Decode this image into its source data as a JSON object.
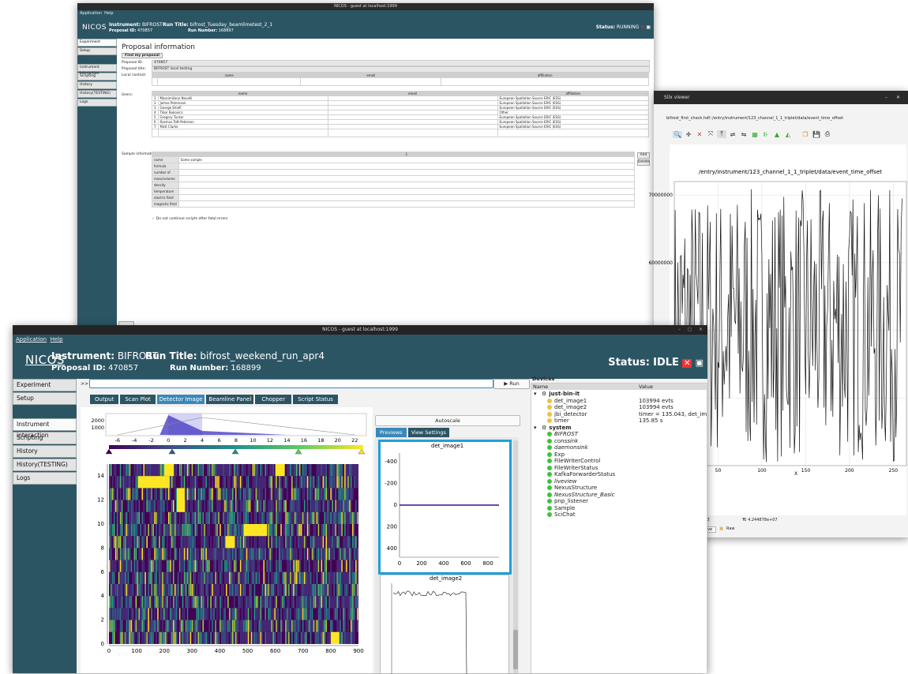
{
  "win1": {
    "title": "NICOS - guest at localhost:1999",
    "menu": [
      "Application",
      "Help"
    ],
    "instrument_label": "Instrument:",
    "instrument": "BIFROST",
    "proposal_label": "Proposal ID:",
    "proposal_id": "470857",
    "run_title_label": "Run Title:",
    "run_title": "bifrost_Tuesday_beamlimetest_2_1",
    "run_number_label": "Run Number:",
    "run_number": "168897",
    "status_label": "Status:",
    "status": "RUNNING",
    "nav": [
      "Experiment",
      "Setup",
      "Instrument interaction",
      "Scripting",
      "History",
      "History(TESTING)",
      "Logs"
    ],
    "heading": "Proposal information",
    "find_button": "Find my proposal",
    "proposal_id_field_label": "Proposal ID:",
    "proposal_id_value": "470857",
    "proposal_title_label": "Proposal title:",
    "proposal_title_value": "BIFROST local testing",
    "local_contact_label": "Local contact:",
    "columns": [
      "name",
      "email",
      "affiliation"
    ],
    "users_label": "Users:",
    "users": [
      {
        "name": "Massimiliano Novelli",
        "affiliation": "European Spallation Source ERIC (ESS)"
      },
      {
        "name": "James Petersson",
        "affiliation": "European Spallation Source ERIC (ESS)"
      },
      {
        "name": "George Ehlefi",
        "affiliation": "European Spallation Source ERIC (ESS)"
      },
      {
        "name": "Tibor Bukovics",
        "affiliation": "Other"
      },
      {
        "name": "Gregory Tucker",
        "affiliation": "European Spallation Source ERIC (ESS)"
      },
      {
        "name": "Rasmus Toft-Petersen",
        "affiliation": "European Spallation Source ERIC (ESS)"
      },
      {
        "name": "Matt Clarke",
        "affiliation": "European Spallation Source ERIC (ESS)"
      }
    ],
    "sample_info_label": "Sample information:",
    "sample_col": "1",
    "sample_rows": [
      "name",
      "formula",
      "number of",
      "mass/volume",
      "density",
      "temperature",
      "electric field",
      "magnetic field"
    ],
    "sample_name_value": "Some sample",
    "add_button": "Add",
    "delete_button": "Delete",
    "checkbox_label": "Do not continue scripts after fatal errors"
  },
  "win2": {
    "title": "Silx viewer",
    "path": "bifrost_first_check.hdf::/entry/instrument/123_channel_1_1_triplet/data/event_time_offset",
    "plot_title": "/entry/instrument/123_channel_1_1_triplet/data/event_time_offset",
    "xlabel": "X",
    "coord_x": "8863",
    "coord_y_label": "Y:",
    "coord_y": "4.244878e+07",
    "curve_tab": "urve",
    "raw_tab": "Raw"
  },
  "win3": {
    "title": "NICOS - guest at localhost:1999",
    "menu": [
      "Application",
      "Help"
    ],
    "instrument_label": "Instrument:",
    "instrument": "BIFROST",
    "proposal_label": "Proposal ID:",
    "proposal_id": "470857",
    "run_title_label": "Run Title:",
    "run_title": "bifrost_weekend_run_apr4",
    "run_number_label": "Run Number:",
    "run_number": "168899",
    "status_label": "Status:",
    "status": "IDLE",
    "nav": [
      "Experiment",
      "Setup",
      "Instrument interaction",
      "Scripting",
      "History",
      "History(TESTING)",
      "Logs"
    ],
    "cmd_prompt": ">>",
    "run_button": "Run",
    "tabs": [
      "Output",
      "Scan Plot",
      "Detector Image",
      "Beamline Panel",
      "Chopper",
      "Script Status"
    ],
    "autoscale": "Autoscale",
    "subtabs": [
      "Previews",
      "View Settings"
    ],
    "preview1_title": "det_image1",
    "preview2_title": "det_image2",
    "devices_title": "Devices",
    "devices_cols": [
      "Name",
      "Value"
    ],
    "groups": [
      {
        "name": "just-bin-it",
        "items": [
          {
            "name": "det_image1",
            "value": "103994 evts",
            "status": "yellow"
          },
          {
            "name": "det_image2",
            "value": "103994 evts",
            "status": "yellow"
          },
          {
            "name": "jbi_detector",
            "value": "timer = 135.043, det_image1",
            "status": "yellow"
          },
          {
            "name": "timer",
            "value": "135.85 s",
            "status": "yellow"
          }
        ]
      },
      {
        "name": "system",
        "items": [
          {
            "name": "BIFROST",
            "value": "",
            "status": "green",
            "italic": true
          },
          {
            "name": "conssink",
            "value": "",
            "status": "green",
            "italic": true
          },
          {
            "name": "daemonsink",
            "value": "",
            "status": "green",
            "italic": true
          },
          {
            "name": "Exp",
            "value": "",
            "status": "green"
          },
          {
            "name": "FileWriterControl",
            "value": "",
            "status": "green"
          },
          {
            "name": "FileWriterStatus",
            "value": "",
            "status": "green"
          },
          {
            "name": "KafkaForwarderStatus",
            "value": "",
            "status": "green"
          },
          {
            "name": "liveview",
            "value": "",
            "status": "green",
            "italic": true
          },
          {
            "name": "NexusStructure",
            "value": "",
            "status": "green"
          },
          {
            "name": "NexusStructure_Basic",
            "value": "",
            "status": "green",
            "italic": true
          },
          {
            "name": "pnp_listener",
            "value": "",
            "status": "green"
          },
          {
            "name": "Sample",
            "value": "",
            "status": "green"
          },
          {
            "name": "SciChat",
            "value": "",
            "status": "green"
          }
        ]
      }
    ]
  },
  "colors": {
    "nicos_bg": "#2c5564",
    "tab_active": "#3a89b8",
    "viridis_low": "#440154",
    "viridis_high": "#fde725",
    "ok": "#3cc43c",
    "warn": "#f0c040"
  },
  "chart_data": [
    {
      "type": "line",
      "title": "/entry/instrument/123_channel_1_1_triplet/data/event_time_offset",
      "xlabel": "X",
      "ylabel": "",
      "xlim": [
        0,
        265
      ],
      "ylim": [
        30000000,
        72000000
      ],
      "xticks": [
        50,
        100,
        150,
        200,
        250
      ],
      "yticks": [
        40000000,
        50000000,
        60000000,
        70000000
      ],
      "series_note": "dense oscillating trace between ~30e6 and ~71e6 over 260 points"
    },
    {
      "type": "heatmap",
      "title": "",
      "xlim": [
        0,
        900
      ],
      "ylim": [
        0,
        15
      ],
      "xticks": [
        0,
        100,
        200,
        300,
        400,
        500,
        600,
        700,
        800,
        900
      ],
      "yticks": [
        0,
        2,
        4,
        6,
        8,
        10,
        12,
        14
      ],
      "colorscale": "viridis",
      "histogram_xticks": [
        -6,
        -4,
        -2,
        0,
        2,
        4,
        6,
        8,
        10,
        12,
        14,
        16,
        18,
        20,
        22
      ],
      "histogram_yticks": [
        1000,
        2000
      ]
    },
    {
      "type": "line",
      "title": "det_image1",
      "xticks": [
        0,
        200,
        400,
        600,
        800
      ],
      "yticks": [
        -400,
        -200,
        0,
        200,
        400
      ],
      "values_note": "flat line at y=0 across x 0 to 900"
    }
  ]
}
